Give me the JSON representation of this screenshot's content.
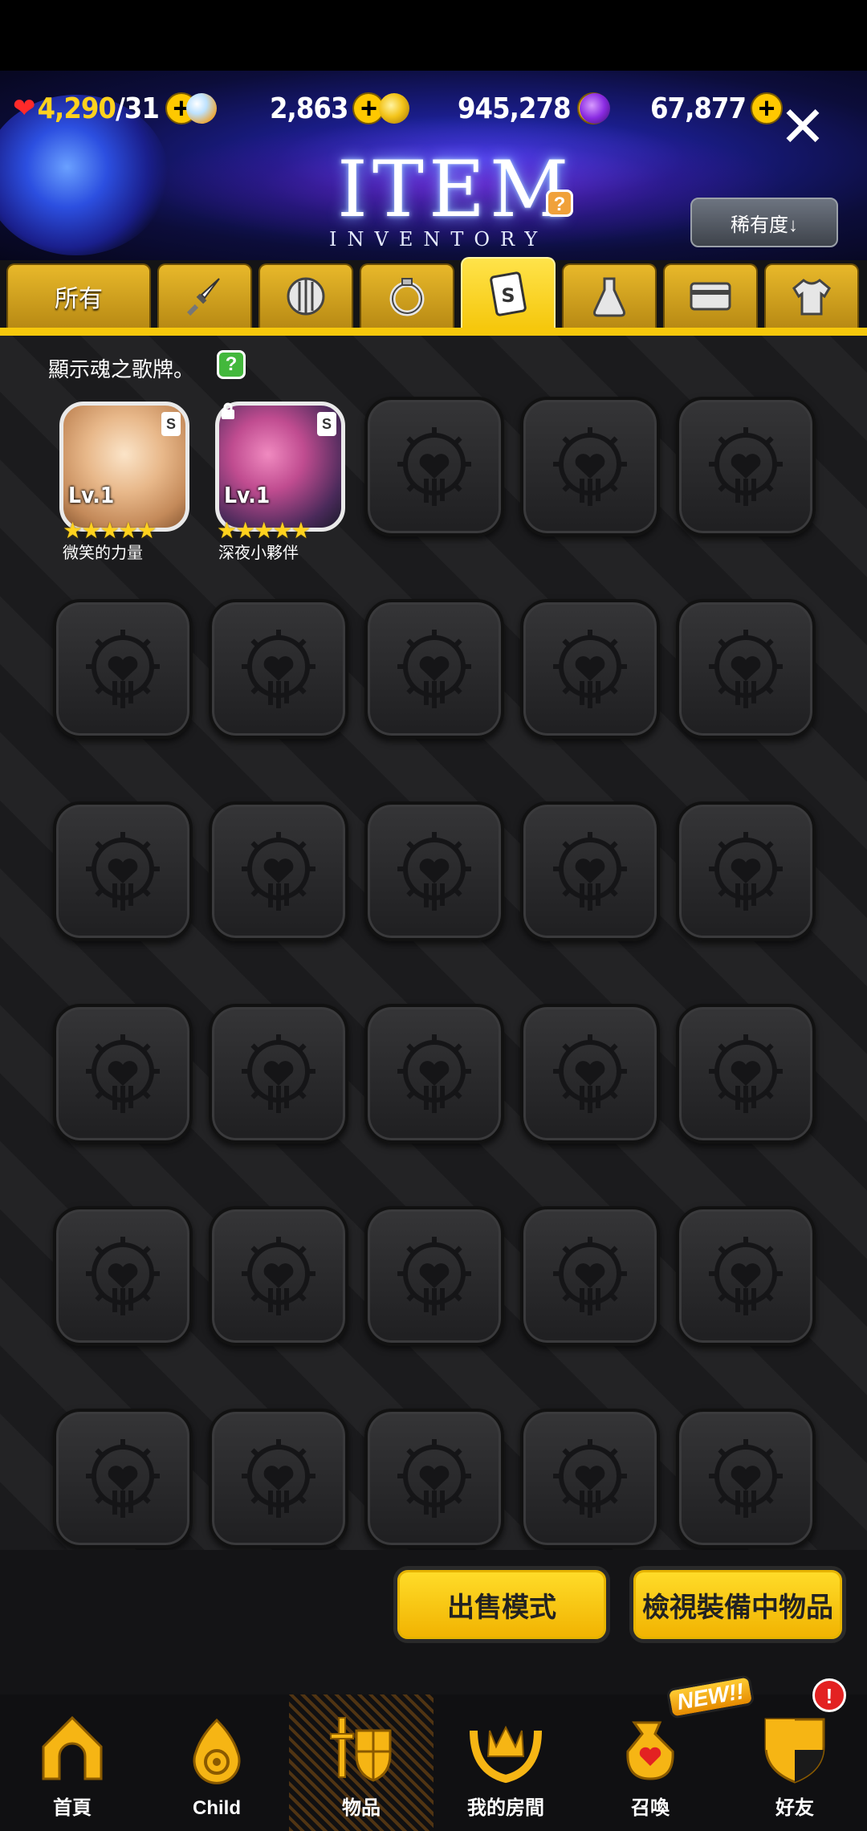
{
  "header": {
    "resources": {
      "hearts": {
        "current": "4,290",
        "max": "/31"
      },
      "crystals": "2,863",
      "gold": "945,278",
      "gems": "67,877"
    },
    "title": "ITEM",
    "subtitle": "INVENTORY",
    "help": "?",
    "sort_button": "稀有度↓"
  },
  "tabs": [
    {
      "label": "所有",
      "icon": "all"
    },
    {
      "icon": "sword-icon"
    },
    {
      "icon": "shield-icon"
    },
    {
      "icon": "ring-icon"
    },
    {
      "icon": "soul-card-icon",
      "card_letter": "S",
      "active": true
    },
    {
      "icon": "potion-icon"
    },
    {
      "icon": "card-icon"
    },
    {
      "icon": "costume-icon"
    }
  ],
  "hint": {
    "text": "顯示魂之歌牌。",
    "help": "?"
  },
  "cards": [
    {
      "name": "微笑的力量",
      "level": "Lv.1",
      "badge": "S",
      "stars": "★★★★★",
      "locked": false
    },
    {
      "name": "深夜小夥伴",
      "level": "Lv.1",
      "badge": "S",
      "stars": "★★★★★",
      "locked": true
    }
  ],
  "actions": {
    "sell_mode": "出售模式",
    "view_equipped": "檢視裝備中物品"
  },
  "nav": [
    {
      "label": "首頁",
      "icon": "home-icon"
    },
    {
      "label": "Child",
      "icon": "child-icon"
    },
    {
      "label": "物品",
      "icon": "items-icon",
      "active": true
    },
    {
      "label": "我的房間",
      "icon": "room-icon"
    },
    {
      "label": "召喚",
      "icon": "summon-icon",
      "badge": "NEW!!"
    },
    {
      "label": "好友",
      "icon": "friends-icon",
      "alert": "!"
    }
  ],
  "colors": {
    "accent": "#f6c80c",
    "header_bg": "#1a1d8a",
    "content_bg": "#1b1b1d"
  }
}
